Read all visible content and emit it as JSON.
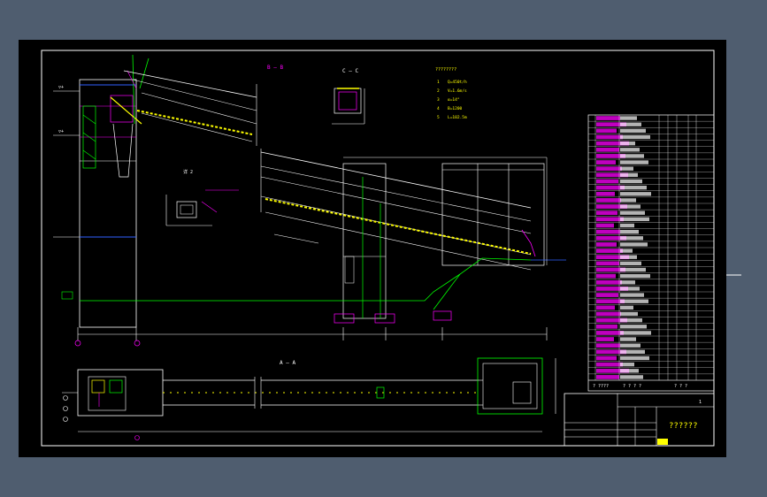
{
  "view": {
    "name": "cad-drawing-viewport"
  },
  "colors": {
    "background": "#4f5d6f",
    "paper": "#000000",
    "frame": "#ffffff",
    "magenta": "#ff00ff",
    "yellow": "#ffff00",
    "cyan": "#00ffff",
    "green": "#00ff00",
    "red": "#ff3030",
    "blue": "#3060ff"
  },
  "labels": {
    "section_bb": "B — B",
    "section_cc": "C — C",
    "section_aa": "A — A",
    "detail_label": "详 2",
    "title_block": "??????",
    "table_footer": "? ????",
    "table_footer_mid": "? ? ? ?",
    "table_footer_right": "? ? ?",
    "sheet_marker": "1",
    "specs_header": "????????"
  },
  "specs": [
    {
      "n": "1",
      "t": "Q=450t/h"
    },
    {
      "n": "2",
      "t": "V=1.6m/s"
    },
    {
      "n": "3",
      "t": "α=14°"
    },
    {
      "n": "4",
      "t": "B=1200"
    },
    {
      "n": "5",
      "t": "L=102.5m"
    }
  ]
}
